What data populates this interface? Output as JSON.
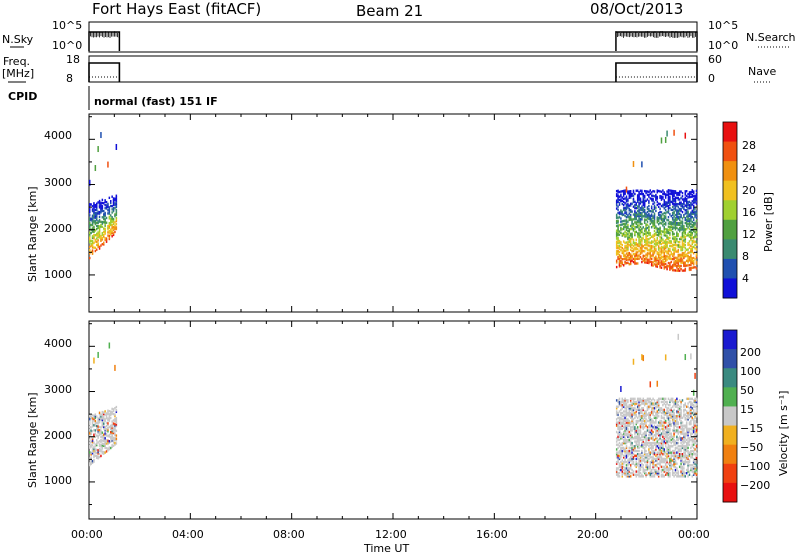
{
  "header": {
    "station": "Fort Hays East (fitACF)",
    "beam": "Beam 21",
    "date": "08/Oct/2013"
  },
  "noise_panel": {
    "left_label": "N.Sky",
    "right_label": "N.Search",
    "left_ticks": [
      "10^5",
      "10^0"
    ],
    "right_ticks": [
      "10^5",
      "10^0"
    ]
  },
  "freq_panel": {
    "left_label_1": "Freq.",
    "left_label_2": "[MHz]",
    "right_label": "Nave",
    "left_ticks": [
      "18",
      "8"
    ],
    "right_ticks": [
      "60",
      "0"
    ]
  },
  "cpid_panel": {
    "left_label": "CPID",
    "mode_text": "normal (fast) 151 IF"
  },
  "power_panel": {
    "ylabel": "Slant Range [km]",
    "yticks": [
      "4000",
      "3000",
      "2000",
      "1000"
    ],
    "colorbar_label": "Power [dB]",
    "colorbar_ticks": [
      "28",
      "24",
      "20",
      "16",
      "12",
      "8",
      "4"
    ],
    "colors": [
      "#1010d8",
      "#2050b0",
      "#3a8a70",
      "#50a040",
      "#a0d030",
      "#f0c020",
      "#f09010",
      "#f05010",
      "#e81010"
    ]
  },
  "velocity_panel": {
    "ylabel": "Slant Range [km]",
    "yticks": [
      "4000",
      "3000",
      "2000",
      "1000"
    ],
    "colorbar_label": "Velocity [m s⁻¹]",
    "colorbar_ticks": [
      "200",
      "100",
      "50",
      "15",
      "−15",
      "−50",
      "−100",
      "−200"
    ],
    "colors": [
      "#1a1ad0",
      "#3050a8",
      "#3a8a80",
      "#50b050",
      "#c8c8c8",
      "#f0b020",
      "#f08010",
      "#f04010",
      "#e81010"
    ]
  },
  "time_axis": {
    "label": "Time UT",
    "ticks": [
      "00:00",
      "04:00",
      "08:00",
      "12:00",
      "16:00",
      "20:00",
      "00:00"
    ]
  },
  "chart_data": [
    {
      "type": "line",
      "name": "noise",
      "xlim": [
        0,
        24
      ],
      "segments": [
        {
          "x": [
            0,
            1.2
          ],
          "level": "high"
        },
        {
          "x": [
            20.8,
            24
          ],
          "level": "high"
        }
      ]
    },
    {
      "type": "line",
      "name": "frequency_nave",
      "xlim": [
        0,
        24
      ],
      "segments": [
        {
          "x": [
            0,
            1.2
          ],
          "freq_mhz": 17
        },
        {
          "x": [
            20.8,
            24
          ],
          "freq_mhz": 17
        }
      ]
    },
    {
      "type": "heatmap",
      "name": "power",
      "xlim": [
        0,
        24
      ],
      "ylim": [
        180,
        4560
      ],
      "zlim": [
        0,
        32
      ],
      "regions": [
        {
          "t0": 0.0,
          "t1": 1.1,
          "r_lo": 1300,
          "r_hi": 2800,
          "peak_db": 28
        },
        {
          "t0": 20.8,
          "t1": 24.0,
          "r_lo": 1100,
          "r_hi": 3000,
          "peak_db": 30
        }
      ]
    },
    {
      "type": "heatmap",
      "name": "velocity",
      "xlim": [
        0,
        24
      ],
      "ylim": [
        180,
        4560
      ],
      "zlim": [
        -250,
        250
      ],
      "regions": [
        {
          "t0": 0.0,
          "t1": 1.1,
          "r_lo": 1300,
          "r_hi": 2700,
          "dominant_mps": 0
        },
        {
          "t0": 20.8,
          "t1": 24.0,
          "r_lo": 1100,
          "r_hi": 3000,
          "dominant_mps": 0
        }
      ]
    }
  ]
}
